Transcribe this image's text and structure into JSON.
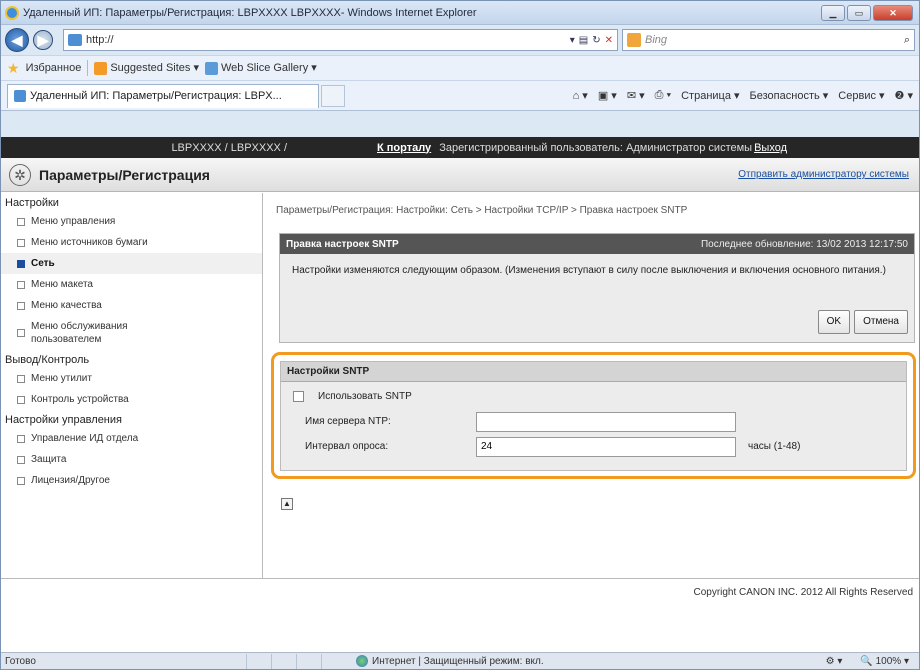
{
  "window": {
    "title": "Удаленный ИП: Параметры/Регистрация: LBPXXXX LBPXXXX- Windows Internet Explorer"
  },
  "address": {
    "url": "http://",
    "search_placeholder": "Bing"
  },
  "favorites": {
    "label": "Избранное",
    "items": [
      "Suggested Sites ▾",
      "Web Slice Gallery ▾"
    ]
  },
  "tab": {
    "title": "Удаленный ИП: Параметры/Регистрация: LBPX..."
  },
  "commands": {
    "page": "Страница ▾",
    "security": "Безопасность ▾",
    "tools": "Сервис ▾",
    "help": "❷ ▾"
  },
  "topbar": {
    "model": "LBPXXXX / LBPXXXX /",
    "portal": "К порталу",
    "user": "Зарегистрированный пользователь: Администратор системы",
    "logout": "Выход"
  },
  "header": {
    "title": "Параметры/Регистрация",
    "mail_admin": "Отправить администратору системы"
  },
  "sidebar": {
    "groups": [
      {
        "label": "Настройки",
        "items": [
          "Меню управления",
          "Меню источников бумаги",
          "Сеть",
          "Меню макета",
          "Меню качества",
          "Меню обслуживания пользователем"
        ]
      },
      {
        "label": "Вывод/Контроль",
        "items": [
          "Меню утилит",
          "Контроль устройства"
        ]
      },
      {
        "label": "Настройки управления",
        "items": [
          "Управление ИД отдела",
          "Защита",
          "Лицензия/Другое"
        ]
      }
    ]
  },
  "breadcrumb": "Параметры/Регистрация: Настройки: Сеть > Настройки TCP/IP > Правка настроек SNTP",
  "edit_panel": {
    "title": "Правка настроек SNTP",
    "last_update": "Последнее обновление: 13/02 2013 12:17:50",
    "message": "Настройки изменяются следующим образом. (Изменения вступают в силу после выключения и включения основного питания.)",
    "ok": "OK",
    "cancel": "Отмена"
  },
  "sntp": {
    "title": "Настройки SNTP",
    "use_sntp": "Использовать SNTP",
    "use_sntp_checked": false,
    "ntp_label": "Имя сервера NTP:",
    "ntp_value": "",
    "interval_label": "Интервал опроса:",
    "interval_value": "24",
    "interval_unit": "часы (1-48)"
  },
  "footer": {
    "copyright": "Copyright CANON INC. 2012 All Rights Reserved"
  },
  "status": {
    "ready": "Готово",
    "zone": "Интернет | Защищенный режим: вкл.",
    "zoom": "100%"
  },
  "colors": {
    "accent_orange": "#f29a1e",
    "topbar": "#262626",
    "panel_header": "#555555"
  }
}
